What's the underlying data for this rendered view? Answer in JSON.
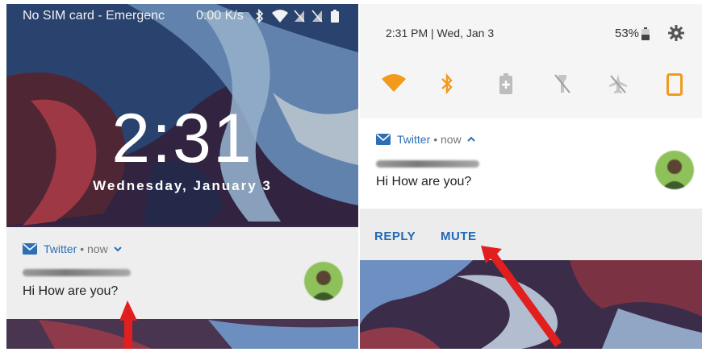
{
  "lock_screen": {
    "status_text": "No SIM card - Emergenc",
    "network_speed": "0.00 K/s",
    "clock": "2:31",
    "date": "Wednesday, January 3",
    "notification": {
      "app": "Twitter",
      "meta": "• now",
      "message": "Hi How are you?"
    }
  },
  "shade": {
    "time_date": "2:31 PM  |  Wed, Jan 3",
    "battery_percent": "53%",
    "tiles": [
      "wifi-icon",
      "bluetooth-icon",
      "battery-saver-icon",
      "flashlight-off-icon",
      "airplane-mode-icon",
      "rotation-icon"
    ],
    "notification": {
      "app": "Twitter",
      "meta": "• now",
      "message": "Hi How are you?",
      "actions": {
        "reply": "REPLY",
        "mute": "MUTE"
      }
    }
  },
  "colors": {
    "accent_orange": "#f29a1c",
    "link_blue": "#2268b8",
    "arrow_red": "#e21f1f"
  }
}
